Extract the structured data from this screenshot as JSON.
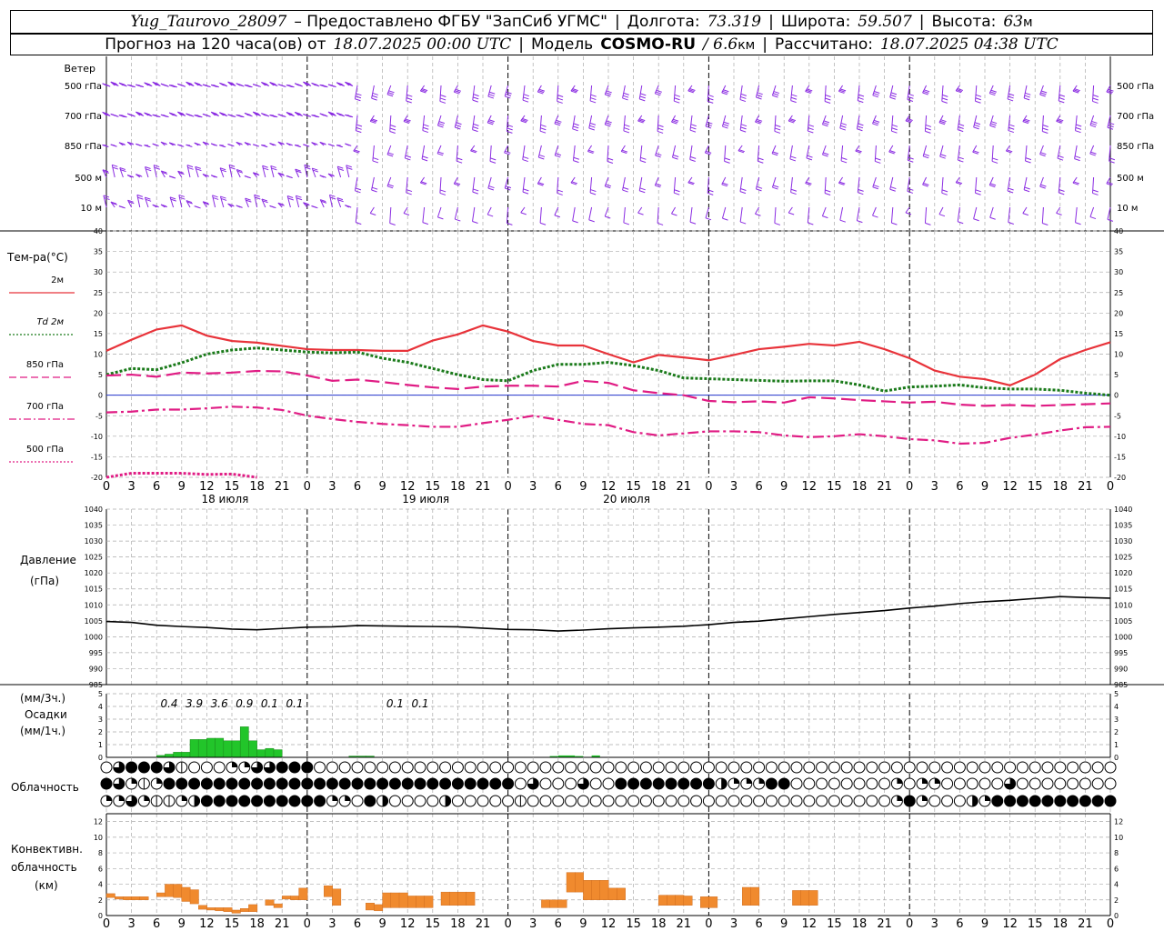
{
  "header": {
    "station": "Yug_Taurovo_28097",
    "provided": "– Предоставлено ФГБУ \"ЗапСиб УГМС\"",
    "lon_label": "Долгота:",
    "lon_value": "73.319",
    "lat_label": "Широта:",
    "lat_value": "59.507",
    "alt_label": "Высота:",
    "alt_value": "63",
    "alt_unit": "м",
    "forecast_label": "Прогноз на 120 часа(ов) от",
    "forecast_time": "18.07.2025 00:00 UTC",
    "model_label": "Модель",
    "model_name": "COSMO-RU",
    "model_res": "/ 6.6",
    "model_res_unit": "км",
    "computed_label": "Рассчитано:",
    "computed_time": "18.07.2025 04:38 UTC",
    "separator": "|"
  },
  "chart_data": [
    {
      "type": "line",
      "panel": "wind",
      "title": "Ветер",
      "levels": [
        "500 гПа",
        "700 гПа",
        "850 гПа",
        "500 м",
        "10 м"
      ],
      "colors": {
        "barb": "#8a2be2"
      }
    },
    {
      "type": "line",
      "panel": "temperature",
      "ylabel": "Те м-ра(°C)",
      "ylim": [
        -20,
        40
      ],
      "yticks": [
        -20,
        -15,
        -10,
        -5,
        0,
        5,
        10,
        15,
        20,
        25,
        30,
        35,
        40
      ],
      "x": [
        0,
        3,
        6,
        9,
        12,
        15,
        18,
        21,
        24,
        27,
        30,
        33,
        36,
        39,
        42,
        45,
        48,
        51,
        54,
        57,
        60,
        63,
        66,
        69,
        72,
        75,
        78,
        81,
        84,
        87,
        90,
        93,
        96,
        99,
        102,
        105,
        108,
        111,
        114,
        117,
        120
      ],
      "series": [
        {
          "name": "2м",
          "color": "#e8333a",
          "style": "solid",
          "values": [
            10.8,
            13.5,
            16,
            17,
            14.5,
            13.2,
            12.8,
            12,
            11.2,
            11,
            11,
            10.8,
            10.8,
            13.3,
            14.8,
            17,
            15.5,
            13.2,
            12.1,
            12.1,
            10,
            8,
            9.8,
            9.2,
            8.5,
            9.8,
            11.2,
            11.8,
            12.5,
            12.1,
            13,
            11.2,
            9,
            6,
            4.5,
            3.9,
            2.4,
            5,
            8.8,
            11,
            12.9
          ]
        },
        {
          "name": "Td 2м",
          "color": "#1a7a1a",
          "style": "dotted",
          "values": [
            5,
            6.5,
            6.2,
            7.9,
            10,
            11,
            11.5,
            11,
            10.5,
            10.3,
            10.5,
            9,
            8,
            6.5,
            5,
            3.8,
            3.5,
            6,
            7.5,
            7.5,
            8,
            7.2,
            6,
            4.2,
            4,
            3.8,
            3.6,
            3.4,
            3.5,
            3.5,
            2.5,
            1,
            2,
            2.2,
            2.5,
            1.8,
            1.5,
            1.5,
            1.2,
            0.5,
            0
          ]
        },
        {
          "name": "850 гПа",
          "color": "#e01c84",
          "style": "long-dash",
          "values": [
            4.8,
            5,
            4.5,
            5.5,
            5.3,
            5.5,
            5.9,
            5.8,
            4.8,
            3.5,
            3.8,
            3.2,
            2.5,
            1.9,
            1.5,
            2.1,
            2.3,
            2.3,
            2.1,
            3.5,
            3,
            1.2,
            0.5,
            0,
            -1.4,
            -1.7,
            -1.5,
            -1.8,
            -0.5,
            -0.8,
            -1.2,
            -1.5,
            -1.8,
            -1.6,
            -2.3,
            -2.6,
            -2.4,
            -2.6,
            -2.4,
            -2.2,
            -2
          ]
        },
        {
          "name": "700 гПа",
          "color": "#e01c84",
          "style": "dash-dot",
          "values": [
            -4.2,
            -4,
            -3.5,
            -3.5,
            -3.2,
            -2.8,
            -3,
            -3.6,
            -5,
            -5.8,
            -6.5,
            -7,
            -7.3,
            -7.7,
            -7.7,
            -6.8,
            -6,
            -5,
            -6,
            -7,
            -7.3,
            -9,
            -9.8,
            -9.3,
            -8.8,
            -8.8,
            -9,
            -9.8,
            -10.2,
            -10,
            -9.5,
            -10,
            -10.7,
            -11,
            -11.8,
            -11.6,
            -10.4,
            -9.6,
            -8.6,
            -7.8,
            -7.7
          ]
        },
        {
          "name": "500 гПа",
          "color": "#e01c84",
          "style": "dotted",
          "values": [
            -20,
            -19,
            -19,
            -19,
            -19.3,
            -19.2,
            -20
          ]
        }
      ],
      "date_labels": [
        "18 июля",
        "19 июля",
        "20 июля"
      ]
    },
    {
      "type": "line",
      "panel": "pressure",
      "ylabel": "Давление (гПа)",
      "ylim": [
        985,
        1040
      ],
      "yticks": [
        985,
        990,
        995,
        1000,
        1005,
        1010,
        1015,
        1020,
        1025,
        1030,
        1035,
        1040
      ],
      "x": [
        0,
        3,
        6,
        9,
        12,
        15,
        18,
        21,
        24,
        27,
        30,
        33,
        36,
        39,
        42,
        45,
        48,
        51,
        54,
        57,
        60,
        63,
        66,
        69,
        72,
        75,
        78,
        81,
        84,
        87,
        90,
        93,
        96,
        99,
        102,
        105,
        108,
        111,
        114,
        117,
        120
      ],
      "series": [
        {
          "name": "Давление",
          "color": "#000000",
          "values": [
            1004.8,
            1004.5,
            1003.6,
            1003.2,
            1002.9,
            1002.4,
            1002.2,
            1002.6,
            1003,
            1003.1,
            1003.5,
            1003.4,
            1003.3,
            1003.2,
            1003.1,
            1002.7,
            1002.3,
            1002.2,
            1001.8,
            1002.1,
            1002.5,
            1002.8,
            1003,
            1003.3,
            1003.8,
            1004.5,
            1004.9,
            1005.6,
            1006.3,
            1007,
            1007.6,
            1008.2,
            1009,
            1009.6,
            1010.4,
            1011,
            1011.4,
            1012,
            1012.6,
            1012.3,
            1012.1
          ]
        }
      ]
    },
    {
      "type": "bar",
      "panel": "precipitation",
      "ylabel": "(мм/3ч.) Осадки (мм/1ч.)",
      "ylim": [
        0,
        5
      ],
      "yticks": [
        0,
        1,
        2,
        3,
        4,
        5
      ],
      "color": "#22c52a",
      "hours": [
        6,
        7,
        8,
        9,
        10,
        11,
        12,
        13,
        14,
        15,
        16,
        17,
        18,
        19,
        20,
        21,
        22,
        23,
        24,
        25,
        26,
        27,
        28,
        29,
        30,
        31,
        32,
        33,
        34,
        35,
        36,
        37,
        38,
        39,
        40
      ],
      "values": [
        0.15,
        0.25,
        0.4,
        0.4,
        1.4,
        1.4,
        1.5,
        1.5,
        1.3,
        1.3,
        2.4,
        1.3,
        0.6,
        0.7,
        0.6,
        0,
        0,
        0,
        0,
        0,
        0,
        0,
        0,
        0.1,
        0.1,
        0.1,
        0,
        0,
        0,
        0,
        0,
        0,
        0,
        0,
        0
      ],
      "late_hours": [
        53,
        54,
        55,
        56,
        57,
        58
      ],
      "late_values": [
        0.1,
        0.15,
        0.15,
        0.1,
        0,
        0.15
      ],
      "labels_3h": [
        {
          "x": 7.5,
          "text": "0.4"
        },
        {
          "x": 10.5,
          "text": "3.9"
        },
        {
          "x": 13.5,
          "text": "3.6"
        },
        {
          "x": 16.5,
          "text": "0.9"
        },
        {
          "x": 19.5,
          "text": "0.1"
        },
        {
          "x": 22.5,
          "text": "0.1"
        },
        {
          "x": 34.5,
          "text": "0.1"
        },
        {
          "x": 37.5,
          "text": "0.1"
        }
      ]
    },
    {
      "type": "table",
      "panel": "cloudiness",
      "title": "Облачность",
      "rows": [
        "upper",
        "middle",
        "lower"
      ],
      "cover_scale": "0-8 oktas",
      "upper": "0,6,8,8,8,6,1,0,0,0,3,3,6,6,8,8,8,0,0,0,0,0,0,0,0,0,0,0,0,0,0,0,0,0,0,0,0,0,0,0,0,0,0,0,0,0,0,0,0,0,0,0,0,0,0,0,0,0,0,0,0,0,0,0,0,0,0,0,0,0,0,0,0,0,0,0,0,0,0,0,0,0,0,0,0,0,0,0,0,0,0,0,0,0,0,0,0,0,0,0,0,0,0,0,0,0,0,0,0,0,0,0,0,0,0,0,0,0,0,0,0,0,0,0,0,0,0,0,0,0,0,0,0,0,0,0,0,0,0",
      "middle": "8,6,3,1,3,8,8,8,8,8,8,8,8,8,8,8,8,8,8,8,8,8,8,8,8,8,8,8,8,8,8,8,8,0,6,0,0,0,6,0,0,8,8,8,8,8,8,8,8,5,3,3,3,8,8,0,0,0,0,0,0,0,0,3,0,3,3,0,0,0,0,0,6,0,0,0,0,0,0,0,0,0,0",
      "lower": "3,3,6,3,2,2,3,5,8,8,8,8,8,8,8,8,8,8,3,3,0,8,5,0,0,0,0,5,0,0,0,0,0,2,0,0,0,0,0,0,0,0,0,0,0,0,0,0,0,0,0,0,0,0,0,0,0,0,0,0,0,0,0,3,8,3,0,0,0,5,3,8,8,8,8,8,8,8,8,8,8,0,0,0,0,0,0,0,0,0,0,0,0,0,0,0,0,0,0,0,3,0,0,0,0,0,0,0,0,0,0,0,0,0,0,0,0,0,0,0,0,0,2,0,0,0,0,0,0,0,0,0,0,0,0,0,0,0"
    },
    {
      "type": "bar",
      "panel": "convective",
      "ylabel": "Конвективн. облачность (км)",
      "ylim": [
        0,
        13
      ],
      "yticks": [
        0,
        2,
        4,
        6,
        8,
        10,
        12
      ],
      "color": "#f08a2e",
      "x": [
        0,
        1,
        2,
        3,
        4,
        5,
        6,
        7,
        8,
        9,
        10,
        11,
        12,
        13,
        14,
        15,
        16,
        17,
        18,
        19,
        20,
        21,
        22,
        23,
        24,
        25,
        26,
        27,
        28,
        29,
        30,
        31,
        32,
        33,
        34,
        35,
        36,
        37,
        38,
        39,
        40,
        41,
        42,
        43,
        44,
        45,
        46,
        47,
        48,
        49,
        50,
        51,
        52,
        53,
        54,
        55,
        56,
        57,
        58,
        59,
        60,
        61,
        62,
        63,
        64,
        65,
        66,
        67,
        68,
        69,
        70,
        71,
        72,
        73,
        74,
        75,
        76,
        77,
        78,
        79,
        80,
        81,
        82,
        83,
        84,
        85,
        86,
        87,
        88,
        89,
        90,
        91,
        92,
        93,
        94,
        95,
        96,
        97,
        98,
        99,
        100,
        101,
        102,
        103,
        104,
        105,
        106,
        107,
        108,
        109,
        110,
        111,
        112,
        113,
        114,
        115,
        116,
        117,
        118,
        119,
        120
      ],
      "base": [
        2.3,
        2.1,
        2,
        2,
        2,
        0,
        2.4,
        2.4,
        2.3,
        1.8,
        1.5,
        0.8,
        0.7,
        0.6,
        0.5,
        0.3,
        0.5,
        0.5,
        0,
        1.3,
        1,
        2.1,
        2,
        2,
        0,
        0,
        2.4,
        1.3,
        0,
        0,
        0,
        0.7,
        0.6,
        1,
        1,
        1,
        1,
        1,
        1,
        0,
        1.3,
        1.3,
        1.3,
        1.3,
        0,
        0,
        0,
        0,
        0,
        0,
        0,
        0,
        1,
        1,
        1,
        3,
        3,
        2,
        2,
        2,
        2,
        2,
        0,
        0,
        0,
        0,
        1.3,
        1.3,
        1.3,
        1.3,
        0,
        1,
        1,
        0,
        0,
        0,
        1.3,
        1.3,
        0,
        0,
        0,
        0,
        1.3,
        1.3,
        1.3,
        0,
        0,
        0,
        0,
        0,
        0,
        0,
        0,
        0,
        0,
        0,
        0,
        0,
        0,
        0,
        0,
        0,
        0,
        0,
        0,
        0,
        0,
        0,
        0,
        0,
        0,
        0,
        0,
        0,
        0,
        0,
        0,
        0,
        0,
        0,
        0,
        0,
        0,
        0
      ],
      "top": [
        2.8,
        2.4,
        2.4,
        2.4,
        2.4,
        0,
        2.9,
        4,
        4,
        3.6,
        3.3,
        1.3,
        1,
        1,
        1,
        0.7,
        0.9,
        1.4,
        0,
        2,
        1.5,
        2.5,
        2.5,
        3.5,
        0,
        0,
        3.8,
        3.4,
        0,
        0,
        0,
        1.6,
        1.4,
        2.9,
        2.9,
        2.9,
        2.5,
        2.5,
        2.5,
        0,
        3,
        3,
        3,
        3,
        0,
        0,
        0,
        0,
        0,
        0,
        0,
        0,
        2,
        2,
        2,
        5.5,
        5.5,
        4.5,
        4.5,
        4.5,
        3.5,
        3.5,
        0,
        0,
        0,
        0,
        2.6,
        2.6,
        2.6,
        2.5,
        0,
        2.4,
        2.4,
        0,
        0,
        0,
        3.6,
        3.6,
        0,
        0,
        0,
        0,
        3.2,
        3.2,
        3.2,
        0,
        0,
        0,
        0,
        0,
        0,
        0,
        0,
        0,
        0,
        0,
        0,
        0,
        0,
        0,
        0,
        0,
        0,
        0,
        0,
        0,
        0,
        0,
        0,
        0,
        0,
        0,
        0,
        0,
        0,
        0,
        0,
        0,
        0,
        0,
        0,
        0,
        0,
        0
      ]
    }
  ],
  "panels": {
    "wind_title": "Ветер",
    "wind_levels": [
      "500 гПа",
      "700 гПа",
      "850 гПа",
      "500 м",
      "10  м"
    ],
    "temp_title": "Тем-ра(°C)",
    "legend": [
      "2м",
      "Td  2м",
      "850 гПа",
      "700 гПа",
      "500 гПа"
    ],
    "pressure_title_1": "Давление",
    "pressure_title_2": "(гПа)",
    "precip_title_1": "(мм/3ч.)",
    "precip_title_2": "Осадки",
    "precip_title_3": "(мм/1ч.)",
    "cloud_title": "Облачность",
    "conv_title_1": "Конвективн.",
    "conv_title_2": "облачность",
    "conv_title_3": "(км)",
    "x_tick_labels": [
      "0",
      "3",
      "6",
      "9",
      "12",
      "15",
      "18",
      "21",
      "0",
      "3",
      "6",
      "9",
      "12",
      "15",
      "18",
      "21",
      "0",
      "3",
      "6",
      "9",
      "12",
      "15",
      "18",
      "21",
      "0",
      "3",
      "6"
    ],
    "date_labels": [
      "18 июля",
      "19 июля",
      "20 июля"
    ]
  }
}
